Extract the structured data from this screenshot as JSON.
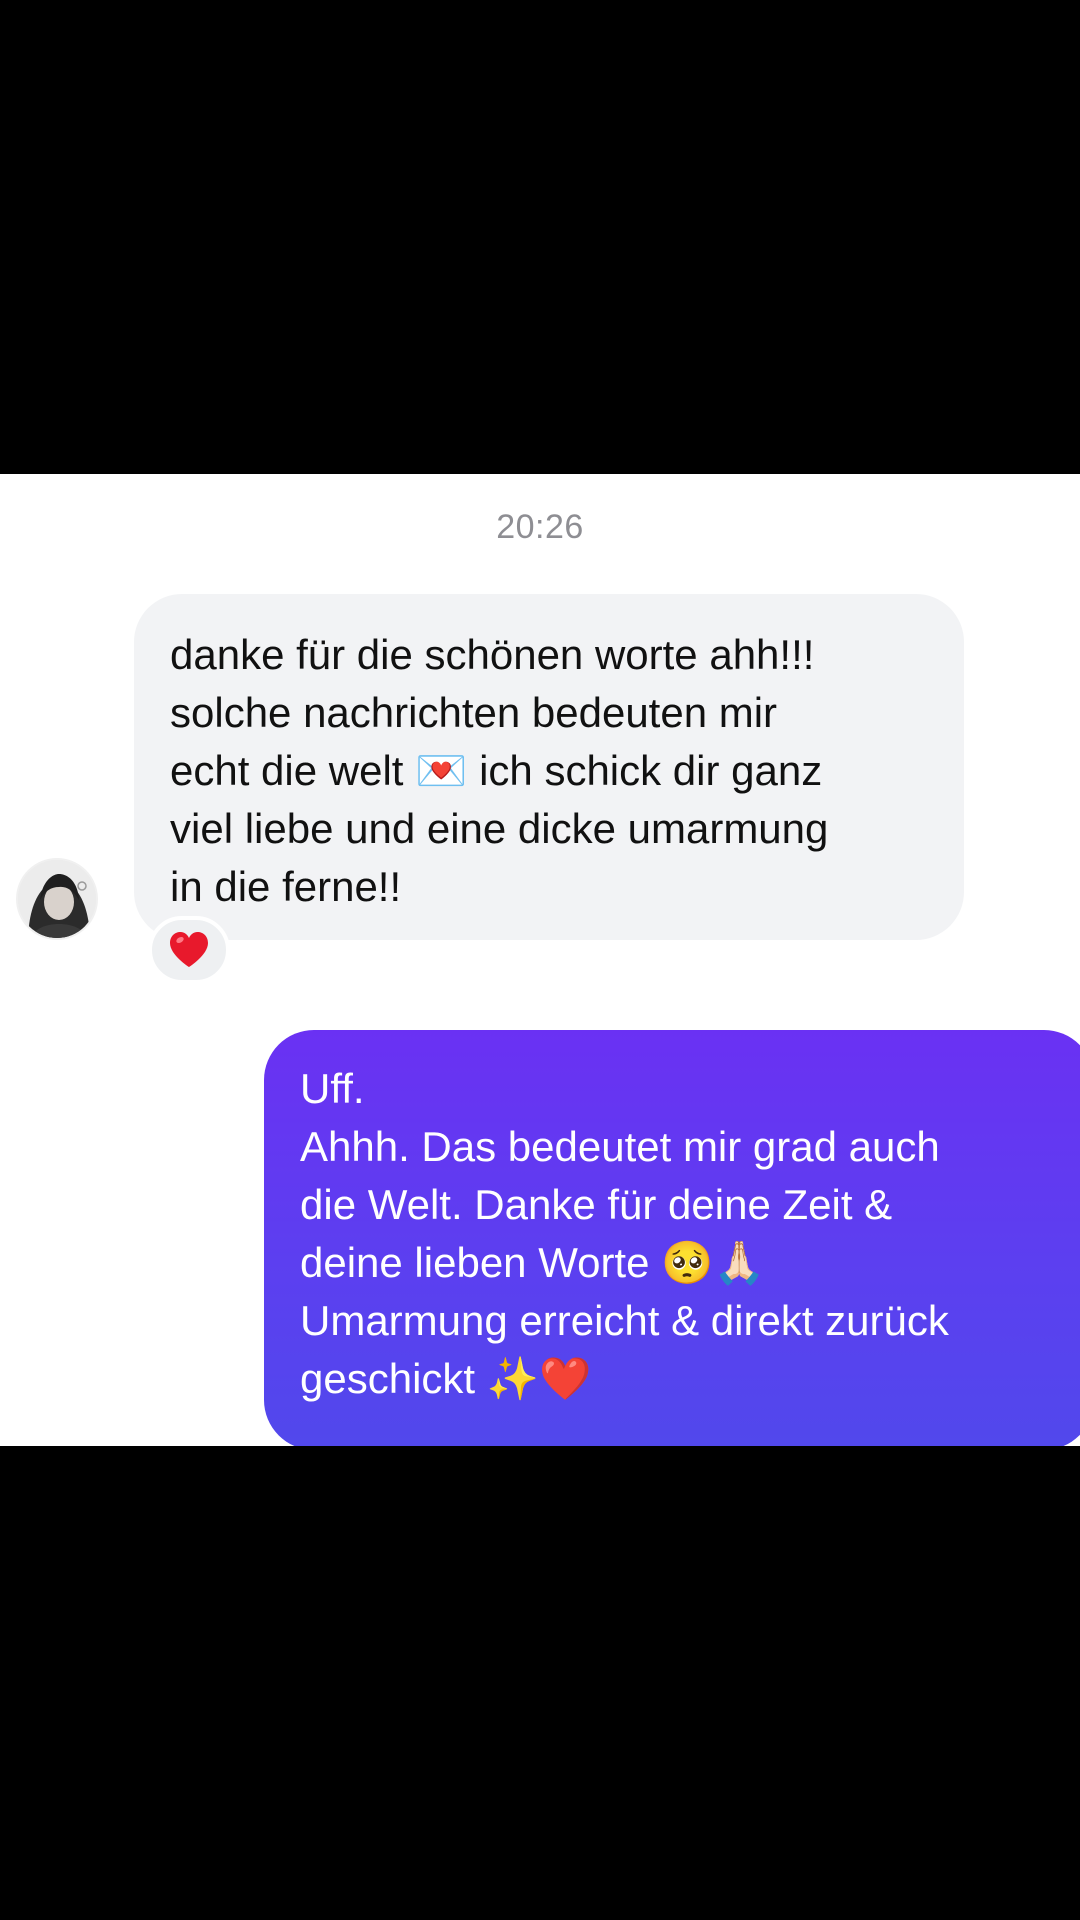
{
  "conversation": {
    "timestamp": "20:26",
    "incoming": {
      "text": "danke für die schönen worte ahh!!!\nsolche nachrichten bedeuten mir\necht die welt 💌 ich schick dir ganz\nviel liebe und eine dicke umarmung\nin die ferne!!",
      "reaction_icon": "red-heart-icon"
    },
    "outgoing": {
      "text": "Uff.\nAhhh. Das bedeutet mir grad auch\ndie Welt. Danke für deine Zeit &\ndeine lieben Worte 🥺🙏🏻\nUmarmung erreicht & direkt zurück\ngeschickt ✨❤️"
    }
  },
  "colors": {
    "background": "#000000",
    "chat_background": "#ffffff",
    "incoming_bubble": "#f2f3f5",
    "outgoing_gradient_top": "#6a31f3",
    "outgoing_gradient_bottom": "#5148ec",
    "timestamp_text": "#8e8e93",
    "heart": "#e8192c"
  }
}
